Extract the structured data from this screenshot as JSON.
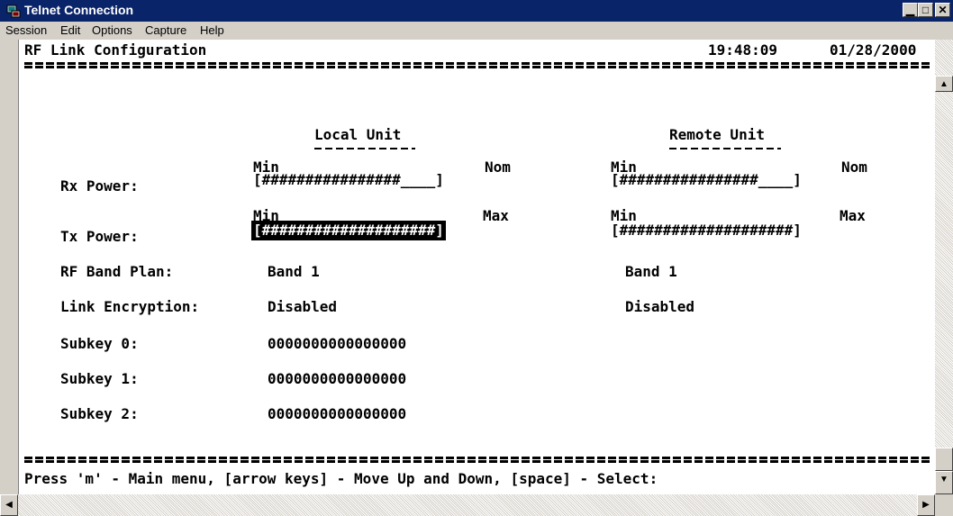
{
  "window": {
    "title": "Telnet Connection",
    "colors": {
      "titlebar": "#0a246a",
      "terminal_bg": "#ffffff"
    }
  },
  "menu": [
    "Session",
    "Edit",
    "Options",
    "Capture",
    "Help"
  ],
  "screen": {
    "heading": "RF Link Configuration",
    "time": "19:48:09",
    "date": "01/28/2000",
    "local_header": "Local Unit",
    "remote_header": "Remote Unit",
    "rx": {
      "label": "Rx Power:",
      "min": "Min",
      "nom": "Nom",
      "local_gauge": "[################____]",
      "remote_gauge": "[################____]"
    },
    "tx": {
      "label": "Tx Power:",
      "min": "Min",
      "max": "Max",
      "local_gauge": "[####################]",
      "remote_gauge": "[####################]"
    },
    "band": {
      "label": "RF Band Plan:",
      "local": "Band 1",
      "remote": "Band 1"
    },
    "encryption": {
      "label": "Link Encryption:",
      "local": "Disabled",
      "remote": "Disabled"
    },
    "subkeys": [
      {
        "label": "Subkey 0:",
        "value": "0000000000000000"
      },
      {
        "label": "Subkey 1:",
        "value": "0000000000000000"
      },
      {
        "label": "Subkey 2:",
        "value": "0000000000000000"
      }
    ],
    "footer": "Press 'm' - Main menu, [arrow keys] - Move Up and Down, [space] - Select:"
  },
  "icons": {
    "app": "telnet-icon"
  }
}
